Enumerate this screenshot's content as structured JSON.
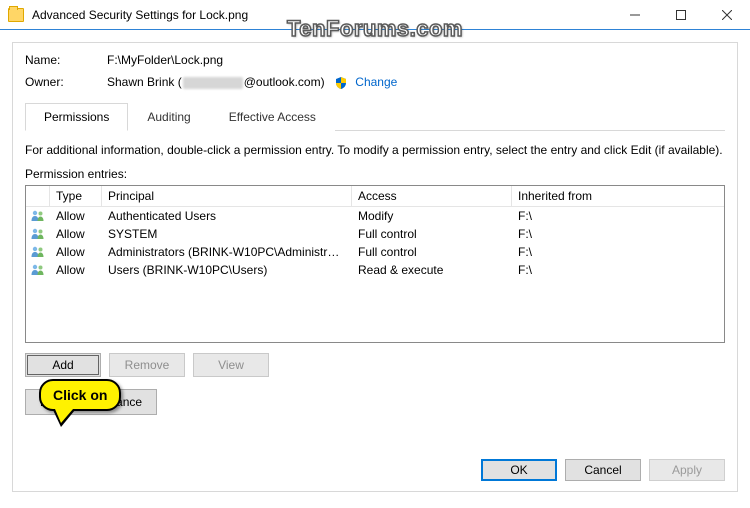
{
  "window": {
    "title": "Advanced Security Settings for Lock.png"
  },
  "watermark": "TenForums.com",
  "fields": {
    "name_label": "Name:",
    "name_value": "F:\\MyFolder\\Lock.png",
    "owner_label": "Owner:",
    "owner_value_prefix": "Shawn Brink",
    "owner_value_suffix": "@outlook.com)",
    "change_label": "Change"
  },
  "tabs": {
    "permissions": "Permissions",
    "auditing": "Auditing",
    "effective": "Effective Access"
  },
  "info_text": "For additional information, double-click a permission entry. To modify a permission entry, select the entry and click Edit (if available).",
  "entries_label": "Permission entries:",
  "columns": {
    "type": "Type",
    "principal": "Principal",
    "access": "Access",
    "inherited": "Inherited from"
  },
  "entries": [
    {
      "type": "Allow",
      "principal": "Authenticated Users",
      "access": "Modify",
      "inherited": "F:\\"
    },
    {
      "type": "Allow",
      "principal": "SYSTEM",
      "access": "Full control",
      "inherited": "F:\\"
    },
    {
      "type": "Allow",
      "principal": "Administrators (BRINK-W10PC\\Administrat...",
      "access": "Full control",
      "inherited": "F:\\"
    },
    {
      "type": "Allow",
      "principal": "Users (BRINK-W10PC\\Users)",
      "access": "Read & execute",
      "inherited": "F:\\"
    }
  ],
  "buttons": {
    "add": "Add",
    "remove": "Remove",
    "view": "View",
    "disable_inherit": "Disable inheritance",
    "ok": "OK",
    "cancel": "Cancel",
    "apply": "Apply"
  },
  "callout": "Click on"
}
